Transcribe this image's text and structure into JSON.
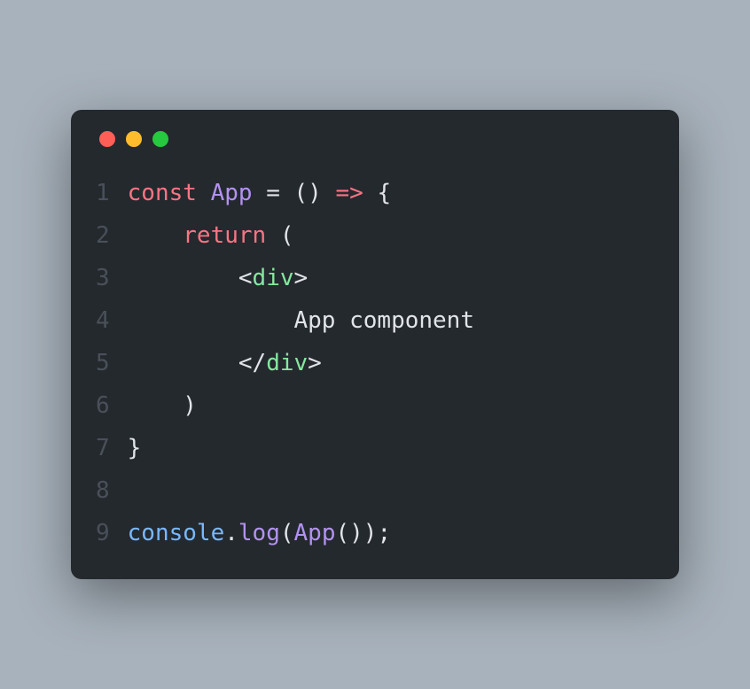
{
  "window": {
    "traffic_lights": {
      "close": "#ff5f56",
      "minimize": "#ffbd2e",
      "zoom": "#27c93f"
    }
  },
  "code": {
    "line_numbers": [
      "1",
      "2",
      "3",
      "4",
      "5",
      "6",
      "7",
      "8",
      "9"
    ],
    "lines": [
      {
        "tokens": [
          {
            "t": "const ",
            "c": "tok-keyword"
          },
          {
            "t": "App ",
            "c": "tok-def"
          },
          {
            "t": "= ",
            "c": "tok-punct"
          },
          {
            "t": "() ",
            "c": "tok-punct"
          },
          {
            "t": "=> ",
            "c": "tok-keyword"
          },
          {
            "t": "{",
            "c": "tok-punct"
          }
        ]
      },
      {
        "tokens": [
          {
            "t": "    ",
            "c": "tok-punct"
          },
          {
            "t": "return ",
            "c": "tok-keyword"
          },
          {
            "t": "(",
            "c": "tok-punct"
          }
        ]
      },
      {
        "tokens": [
          {
            "t": "        ",
            "c": "tok-punct"
          },
          {
            "t": "<",
            "c": "tok-tag-bracket"
          },
          {
            "t": "div",
            "c": "tok-tag-name"
          },
          {
            "t": ">",
            "c": "tok-tag-bracket"
          }
        ]
      },
      {
        "tokens": [
          {
            "t": "            App component",
            "c": "tok-text"
          }
        ]
      },
      {
        "tokens": [
          {
            "t": "        ",
            "c": "tok-punct"
          },
          {
            "t": "</",
            "c": "tok-tag-bracket"
          },
          {
            "t": "div",
            "c": "tok-tag-name"
          },
          {
            "t": ">",
            "c": "tok-tag-bracket"
          }
        ]
      },
      {
        "tokens": [
          {
            "t": "    )",
            "c": "tok-punct"
          }
        ]
      },
      {
        "tokens": [
          {
            "t": "}",
            "c": "tok-punct"
          }
        ]
      },
      {
        "tokens": [
          {
            "t": "",
            "c": "tok-punct"
          }
        ]
      },
      {
        "tokens": [
          {
            "t": "console",
            "c": "tok-obj"
          },
          {
            "t": ".",
            "c": "tok-punct"
          },
          {
            "t": "log",
            "c": "tok-method"
          },
          {
            "t": "(",
            "c": "tok-punct"
          },
          {
            "t": "App",
            "c": "tok-call"
          },
          {
            "t": "());",
            "c": "tok-punct"
          }
        ]
      }
    ]
  }
}
